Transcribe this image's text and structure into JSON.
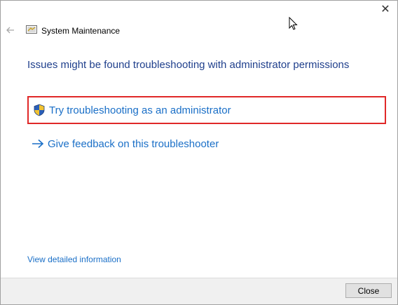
{
  "window": {
    "title": "System Maintenance",
    "close_glyph": "✕"
  },
  "icons": {
    "back": "back-arrow-icon",
    "app": "system-maintenance-icon",
    "shield": "uac-shield-icon",
    "arrow": "arrow-right-icon"
  },
  "main": {
    "heading": "Issues might be found troubleshooting with administrator permissions",
    "options": [
      {
        "label": "Try troubleshooting as an administrator"
      },
      {
        "label": "Give feedback on this troubleshooter"
      }
    ],
    "details_link": "View detailed information"
  },
  "footer": {
    "close_label": "Close"
  },
  "colors": {
    "heading": "#1f3f8c",
    "link": "#1a6fc7",
    "highlight_border": "#e02828"
  }
}
